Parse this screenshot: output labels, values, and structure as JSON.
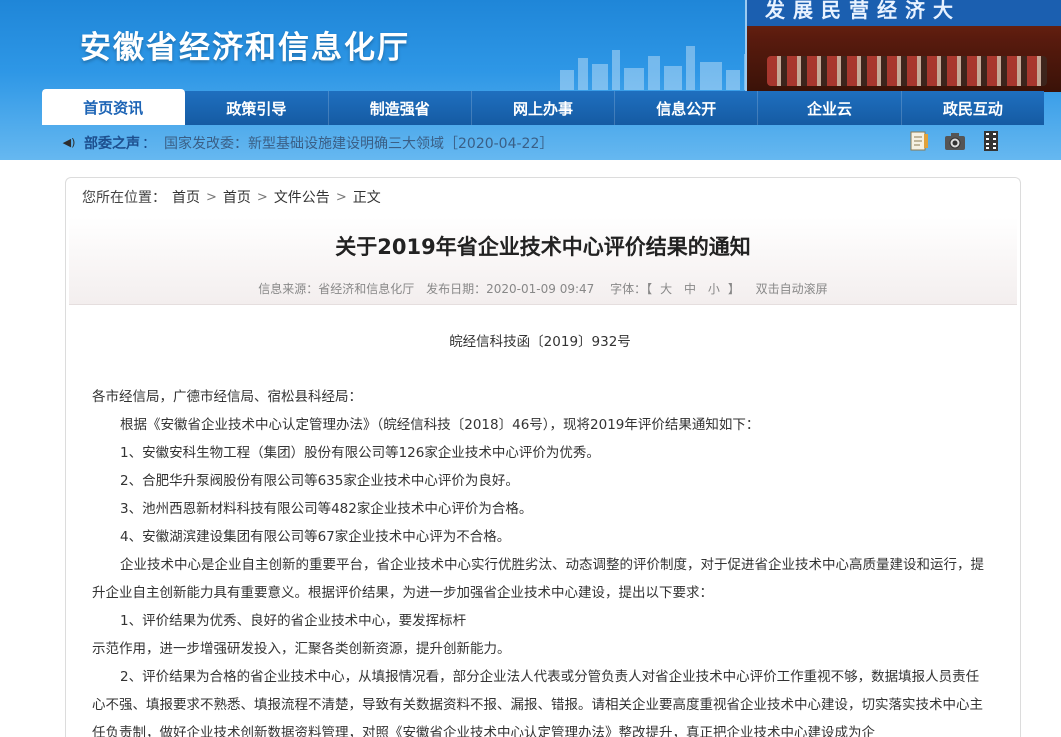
{
  "site": {
    "title": "安徽省经济和信息化厅",
    "banner_slogan": "发展民营经济大"
  },
  "nav": [
    {
      "label": "首页资讯",
      "active": true
    },
    {
      "label": "政策引导",
      "active": false
    },
    {
      "label": "制造强省",
      "active": false
    },
    {
      "label": "网上办事",
      "active": false
    },
    {
      "label": "信息公开",
      "active": false
    },
    {
      "label": "企业云",
      "active": false
    },
    {
      "label": "政民互动",
      "active": false
    }
  ],
  "ticker": {
    "label": "部委之声",
    "sep": "：",
    "news": "国家发改委：新型基础设施建设明确三大领域［2020-04-22］"
  },
  "tools": [
    "notepad-icon",
    "camera-icon",
    "film-icon"
  ],
  "breadcrumb": {
    "prefix": "您所在位置：",
    "items": [
      "首页",
      "首页",
      "文件公告",
      "正文"
    ]
  },
  "article": {
    "title": "关于2019年省企业技术中心评价结果的通知",
    "meta": {
      "source": "信息来源：省经济和信息化厅",
      "date": "发布日期：2020-01-09 09:47",
      "font_label": "字体：【",
      "font_big": "大",
      "font_mid": "中",
      "font_small": "小",
      "font_close": "】",
      "autoscroll": "双击自动滚屏"
    },
    "doc_number": "皖经信科技函〔2019〕932号",
    "paragraphs": [
      {
        "text": "各市经信局，广德市经信局、宿松县科经局：",
        "indent": false
      },
      {
        "text": "根据《安徽省企业技术中心认定管理办法》（皖经信科技〔2018〕46号），现将2019年评价结果通知如下：",
        "indent": true
      },
      {
        "text": "1、安徽安科生物工程（集团）股份有限公司等126家企业技术中心评价为优秀。",
        "indent": true
      },
      {
        "text": "2、合肥华升泵阀股份有限公司等635家企业技术中心评价为良好。",
        "indent": true
      },
      {
        "text": "3、池州西恩新材料科技有限公司等482家企业技术中心评价为合格。",
        "indent": true
      },
      {
        "text": "4、安徽湖滨建设集团有限公司等67家企业技术中心评为不合格。",
        "indent": true
      },
      {
        "text": "企业技术中心是企业自主创新的重要平台，省企业技术中心实行优胜劣汰、动态调整的评价制度，对于促进省企业技术中心高质量建设和运行，提升企业自主创新能力具有重要意义。根据评价结果，为进一步加强省企业技术中心建设，提出以下要求：",
        "indent": true
      },
      {
        "text": "1、评价结果为优秀、良好的省企业技术中心，要发挥标杆",
        "indent": true
      },
      {
        "text": "示范作用，进一步增强研发投入，汇聚各类创新资源，提升创新能力。",
        "indent": false
      },
      {
        "text": "2、评价结果为合格的省企业技术中心，从填报情况看，部分企业法人代表或分管负责人对省企业技术中心评价工作重视不够，数据填报人员责任心不强、填报要求不熟悉、填报流程不清楚，导致有关数据资料不报、漏报、错报。请相关企业要高度重视省企业技术中心建设，切实落实技术中心主任负责制，做好企业技术创新数据资料管理，对照《安徽省企业技术中心认定管理办法》整改提升，真正把企业技术中心建设成为企",
        "indent": true
      }
    ]
  }
}
